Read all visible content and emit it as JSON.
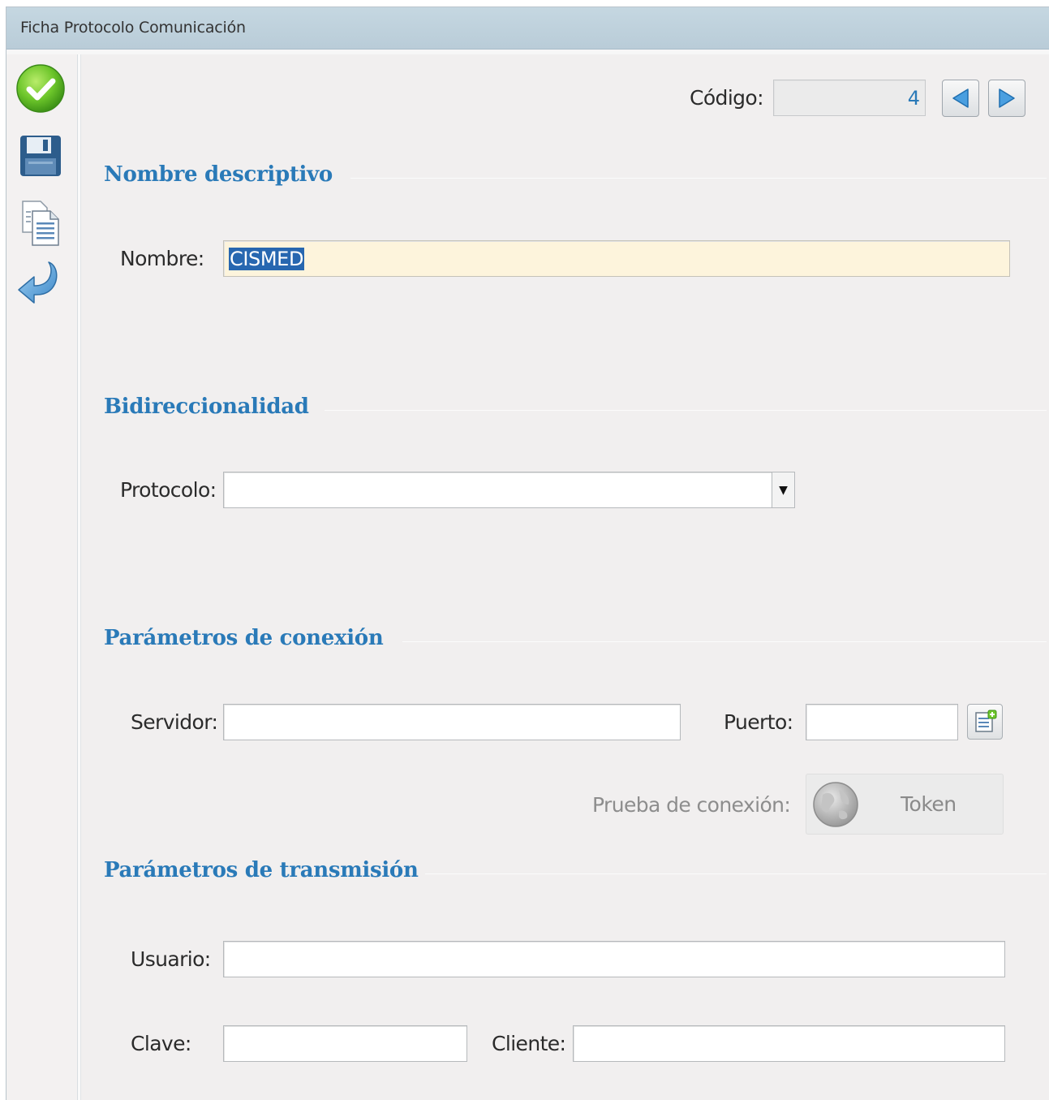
{
  "window": {
    "title": "Ficha Protocolo Comunicación"
  },
  "toolbar": {
    "items": [
      {
        "name": "accept",
        "icon": "check-circle-icon"
      },
      {
        "name": "save",
        "icon": "floppy-disk-icon"
      },
      {
        "name": "copy",
        "icon": "copy-documents-icon"
      },
      {
        "name": "back",
        "icon": "return-arrow-icon"
      }
    ]
  },
  "header": {
    "codigo_label": "Código:",
    "codigo_value": "4",
    "prev_icon": "triangle-left-icon",
    "next_icon": "triangle-right-icon"
  },
  "sections": {
    "nombre_descriptivo": {
      "title": "Nombre descriptivo",
      "nombre_label": "Nombre:",
      "nombre_value": "CISMED"
    },
    "bidireccionalidad": {
      "title": "Bidireccionalidad",
      "protocolo_label": "Protocolo:",
      "protocolo_value": ""
    },
    "conexion": {
      "title": "Parámetros de conexión",
      "servidor_label": "Servidor:",
      "servidor_value": "",
      "puerto_label": "Puerto:",
      "puerto_value": "",
      "prueba_label": "Prueba de conexión:",
      "token_label": "Token",
      "token_icon": "globe-icon",
      "puerto_btn_icon": "document-add-icon"
    },
    "transmision": {
      "title": "Parámetros de transmisión",
      "usuario_label": "Usuario:",
      "usuario_value": "",
      "clave_label": "Clave:",
      "clave_value": "",
      "cliente_label": "Cliente:",
      "cliente_value": ""
    }
  },
  "colors": {
    "section_title": "#2a7ab8",
    "titlebar": "#c5d7e1",
    "name_field_bg": "#fdf4dc",
    "selection": "#2767b0"
  }
}
